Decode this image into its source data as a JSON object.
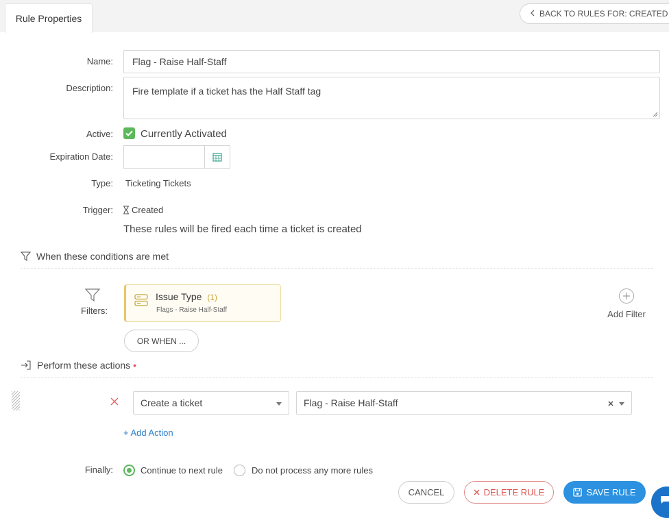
{
  "header": {
    "tab_label": "Rule Properties",
    "back_button_label": "BACK TO RULES FOR: CREATED"
  },
  "form": {
    "name_label": "Name:",
    "name_value": "Flag - Raise Half-Staff",
    "description_label": "Description:",
    "description_value": "Fire template if a ticket has the Half Staff tag",
    "active_label": "Active:",
    "active_text": "Currently Activated",
    "active_checked": true,
    "expiration_label": "Expiration Date:",
    "expiration_value": "",
    "type_label": "Type:",
    "type_value": "Ticketing Tickets",
    "trigger_label": "Trigger:",
    "trigger_value": "Created",
    "trigger_desc": "These rules will be fired each time a ticket is created"
  },
  "conditions": {
    "heading": "When these conditions are met",
    "filters_label": "Filters:",
    "filter_card": {
      "title": "Issue Type",
      "count": "(1)",
      "subtitle": "Flags - Raise Half-Staff"
    },
    "or_when_label": "OR WHEN ...",
    "add_filter_label": "Add Filter"
  },
  "actions": {
    "heading": "Perform these actions",
    "required_mark": "•",
    "action_type": "Create a ticket",
    "action_value": "Flag - Raise Half-Staff",
    "add_action_label": "+ Add Action"
  },
  "finally": {
    "label": "Finally:",
    "options": [
      "Continue to next rule",
      "Do not process any more rules"
    ],
    "selected": "Continue to next rule"
  },
  "footer": {
    "cancel_label": "CANCEL",
    "delete_label": "DELETE RULE",
    "save_label": "SAVE RULE"
  },
  "colors": {
    "accent_blue": "#2b91e0",
    "success_green": "#5cb85c",
    "danger_red": "#d9534f",
    "filter_gold": "#c8a43c"
  }
}
